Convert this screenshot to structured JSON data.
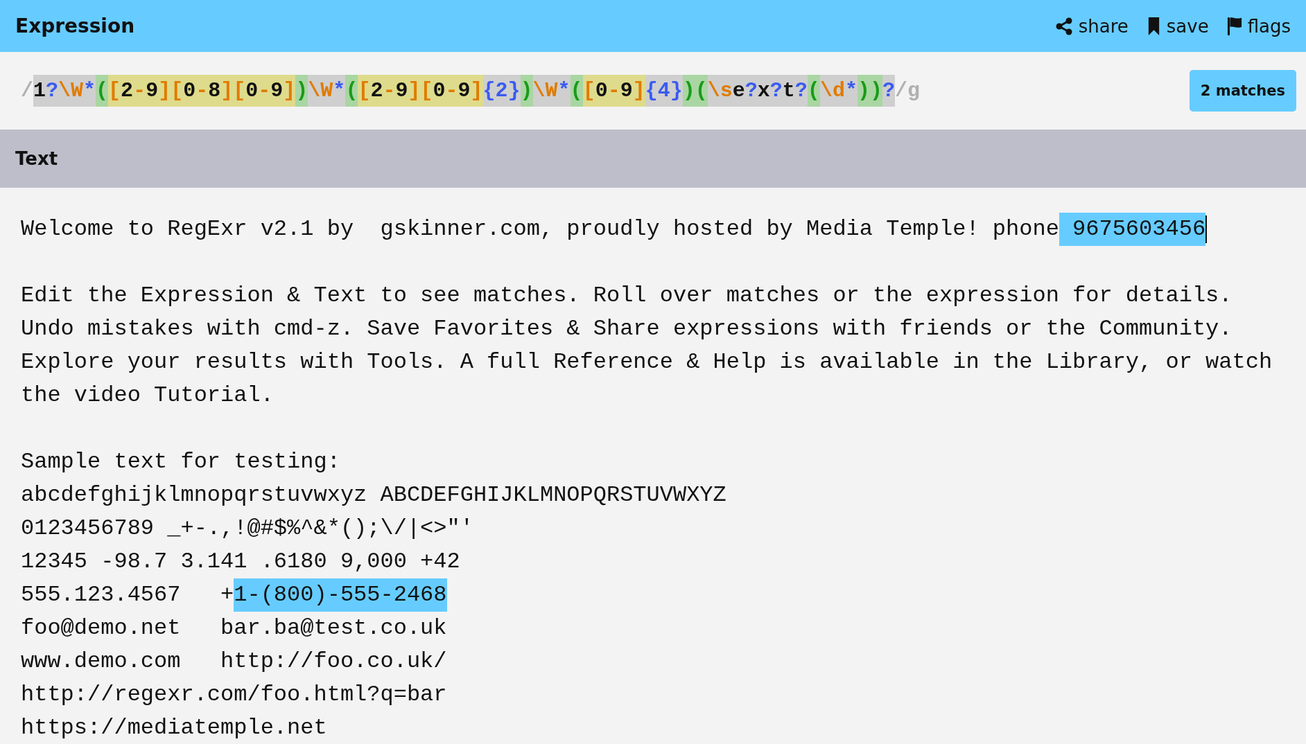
{
  "header": {
    "title": "Expression",
    "actions": [
      {
        "label": "share",
        "kind": "share"
      },
      {
        "label": "save",
        "kind": "save"
      },
      {
        "label": "flags",
        "kind": "flags"
      }
    ]
  },
  "expression": {
    "tokens": [
      {
        "t": "/",
        "kind": "delim"
      },
      {
        "t": "1",
        "kind": "literal"
      },
      {
        "t": "?",
        "kind": "quant"
      },
      {
        "t": "\\W",
        "kind": "escape"
      },
      {
        "t": "*",
        "kind": "quant"
      },
      {
        "t": "(",
        "kind": "group"
      },
      {
        "t": "[",
        "kind": "set"
      },
      {
        "t": "2",
        "kind": "setchar"
      },
      {
        "t": "-",
        "kind": "set"
      },
      {
        "t": "9",
        "kind": "setchar"
      },
      {
        "t": "]",
        "kind": "set"
      },
      {
        "t": "[",
        "kind": "set"
      },
      {
        "t": "0",
        "kind": "setchar"
      },
      {
        "t": "-",
        "kind": "set"
      },
      {
        "t": "8",
        "kind": "setchar"
      },
      {
        "t": "]",
        "kind": "set"
      },
      {
        "t": "[",
        "kind": "set"
      },
      {
        "t": "0",
        "kind": "setchar"
      },
      {
        "t": "-",
        "kind": "set"
      },
      {
        "t": "9",
        "kind": "setchar"
      },
      {
        "t": "]",
        "kind": "set"
      },
      {
        "t": ")",
        "kind": "group"
      },
      {
        "t": "\\W",
        "kind": "escape"
      },
      {
        "t": "*",
        "kind": "quant"
      },
      {
        "t": "(",
        "kind": "group"
      },
      {
        "t": "[",
        "kind": "set"
      },
      {
        "t": "2",
        "kind": "setchar"
      },
      {
        "t": "-",
        "kind": "set"
      },
      {
        "t": "9",
        "kind": "setchar"
      },
      {
        "t": "]",
        "kind": "set"
      },
      {
        "t": "[",
        "kind": "set"
      },
      {
        "t": "0",
        "kind": "setchar"
      },
      {
        "t": "-",
        "kind": "set"
      },
      {
        "t": "9",
        "kind": "setchar"
      },
      {
        "t": "]",
        "kind": "set"
      },
      {
        "t": "{2}",
        "kind": "quant"
      },
      {
        "t": ")",
        "kind": "group"
      },
      {
        "t": "\\W",
        "kind": "escape"
      },
      {
        "t": "*",
        "kind": "quant"
      },
      {
        "t": "(",
        "kind": "group"
      },
      {
        "t": "[",
        "kind": "set"
      },
      {
        "t": "0",
        "kind": "setchar"
      },
      {
        "t": "-",
        "kind": "set"
      },
      {
        "t": "9",
        "kind": "setchar"
      },
      {
        "t": "]",
        "kind": "set"
      },
      {
        "t": "{4}",
        "kind": "quant"
      },
      {
        "t": ")",
        "kind": "group"
      },
      {
        "t": "(",
        "kind": "group"
      },
      {
        "t": "\\s",
        "kind": "escape"
      },
      {
        "t": "e",
        "kind": "literal"
      },
      {
        "t": "?",
        "kind": "quant"
      },
      {
        "t": "x",
        "kind": "literal"
      },
      {
        "t": "?",
        "kind": "quant"
      },
      {
        "t": "t",
        "kind": "literal"
      },
      {
        "t": "?",
        "kind": "quant"
      },
      {
        "t": "(",
        "kind": "group"
      },
      {
        "t": "\\d",
        "kind": "escape"
      },
      {
        "t": "*",
        "kind": "quant"
      },
      {
        "t": ")",
        "kind": "group"
      },
      {
        "t": ")",
        "kind": "group"
      },
      {
        "t": "?",
        "kind": "quant"
      },
      {
        "t": "/g",
        "kind": "delim"
      }
    ],
    "match_count": "2 matches"
  },
  "text_section": {
    "title": "Text",
    "blocks": [
      {
        "lines": [
          [
            {
              "text": "Welcome to RegExr v2.1 by  gskinner.com, proudly hosted by Media Temple! phone",
              "match": false
            },
            {
              "text": " 9675603456",
              "match": true
            }
          ]
        ]
      },
      {
        "lines": [
          [
            {
              "text": "Edit the Expression & Text to see matches. Roll over matches or the expression for details.",
              "match": false
            }
          ],
          [
            {
              "text": "Undo mistakes with cmd-z. Save Favorites & Share expressions with friends or the Community.",
              "match": false
            }
          ],
          [
            {
              "text": "Explore your results with Tools. A full Reference & Help is available in the Library, or watch",
              "match": false
            }
          ],
          [
            {
              "text": "the video Tutorial.",
              "match": false
            }
          ]
        ]
      },
      {
        "lines": [
          [
            {
              "text": "Sample text for testing:",
              "match": false
            }
          ],
          [
            {
              "text": "abcdefghijklmnopqrstuvwxyz ABCDEFGHIJKLMNOPQRSTUVWXYZ",
              "match": false
            }
          ],
          [
            {
              "text": "0123456789 _+-.,!@#$%^&*();\\/|<>\"'",
              "match": false
            }
          ],
          [
            {
              "text": "12345 -98.7 3.141 .6180 9,000 +42",
              "match": false
            }
          ],
          [
            {
              "text": "555.123.4567   +",
              "match": false
            },
            {
              "text": "1-(800)-555-2468",
              "match": true
            }
          ],
          [
            {
              "text": "foo@demo.net   bar.ba@test.co.uk",
              "match": false
            }
          ],
          [
            {
              "text": "www.demo.com   http://foo.co.uk/",
              "match": false
            }
          ],
          [
            {
              "text": "http://regexr.com/foo.html?q=bar",
              "match": false
            }
          ],
          [
            {
              "text": "https://mediatemple.net",
              "match": false
            }
          ]
        ]
      }
    ]
  }
}
